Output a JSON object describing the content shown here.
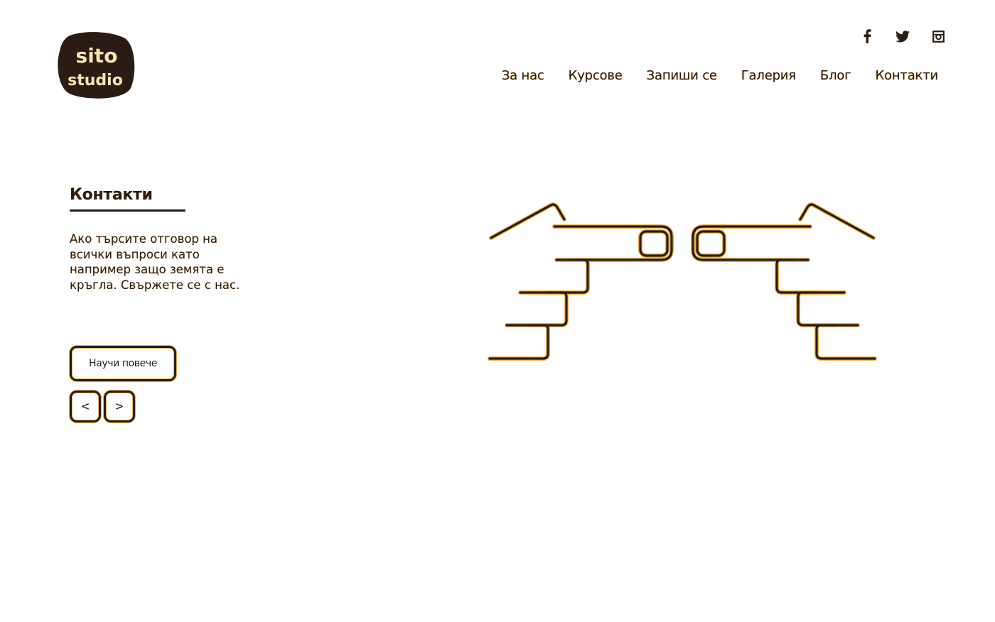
{
  "brand": {
    "logo_line1": "sito",
    "logo_line2": "studio"
  },
  "social": [
    {
      "icon": "facebook-icon"
    },
    {
      "icon": "twitter-icon"
    },
    {
      "icon": "instagram-icon"
    }
  ],
  "nav": {
    "items": [
      "За нас",
      "Курсове",
      "Запиши се",
      "Галерия",
      "Блог",
      "Контакти"
    ]
  },
  "main": {
    "title": "Контакти",
    "description": "Ако търсите отговор на всички въпроси като например защо земята е кръгла. Свържете се с нас.",
    "cta_label": "Научи повече",
    "prev_label": "<",
    "next_label": ">"
  },
  "colors": {
    "ink": "#2a1c14",
    "glow": "#f0b24a",
    "background": "#ffffff"
  }
}
